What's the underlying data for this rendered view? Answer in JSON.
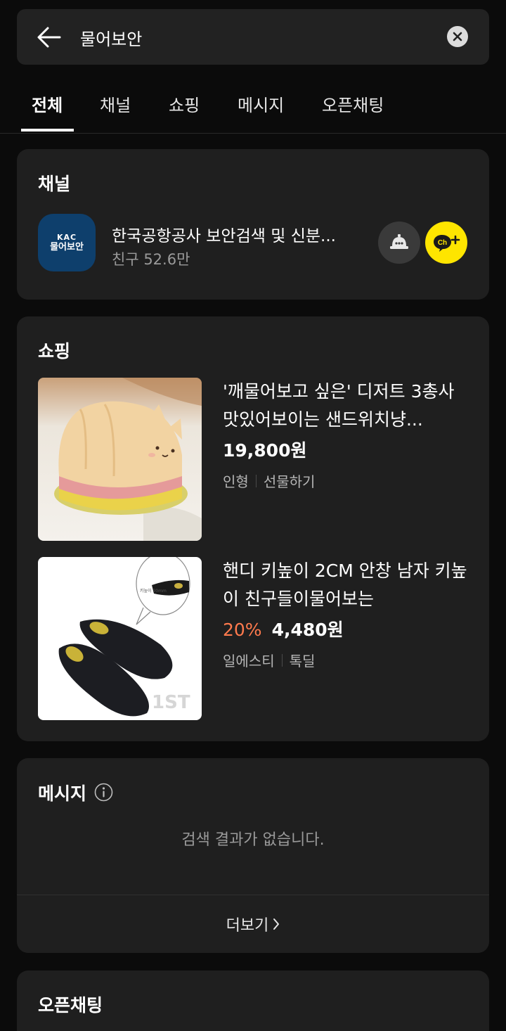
{
  "search": {
    "query": "물어보안"
  },
  "tabs": [
    {
      "label": "전체",
      "active": true
    },
    {
      "label": "채널",
      "active": false
    },
    {
      "label": "쇼핑",
      "active": false
    },
    {
      "label": "메시지",
      "active": false
    },
    {
      "label": "오픈채팅",
      "active": false
    }
  ],
  "channel_section": {
    "title": "채널",
    "item": {
      "logo_text_top": "KAC",
      "logo_text_bottom": "물어보안",
      "name": "한국공항공사 보안검색 및 신분...",
      "friends": "친구 52.6만",
      "alarm_icon": "bell-icon",
      "add_icon": "channel-add-icon",
      "add_label": "Ch+",
      "add_color": "#fee500"
    }
  },
  "shopping_section": {
    "title": "쇼핑",
    "products": [
      {
        "title": "'깨물어보고 싶은' 디저트 3총사 맛있어보이는 샌드위치냥...",
        "discount": "",
        "price": "19,800원",
        "meta": [
          "인형",
          "선물하기"
        ]
      },
      {
        "title": "핸디 키높이 2CM 안창 남자 키높이 친구들이물어보는",
        "discount": "20%",
        "price": "4,480원",
        "meta": [
          "일에스티",
          "톡딜"
        ],
        "image_callout": "키높이 20mm",
        "image_watermark": "1ST"
      }
    ]
  },
  "message_section": {
    "title": "메시지",
    "empty_text": "검색 결과가 없습니다.",
    "more_label": "더보기"
  },
  "openchat_section": {
    "title": "오픈채팅"
  },
  "colors": {
    "background": "#0b0b0b",
    "card": "#1f1f1f",
    "accent_discount": "#ff7a4d",
    "kakao_yellow": "#fee500"
  }
}
